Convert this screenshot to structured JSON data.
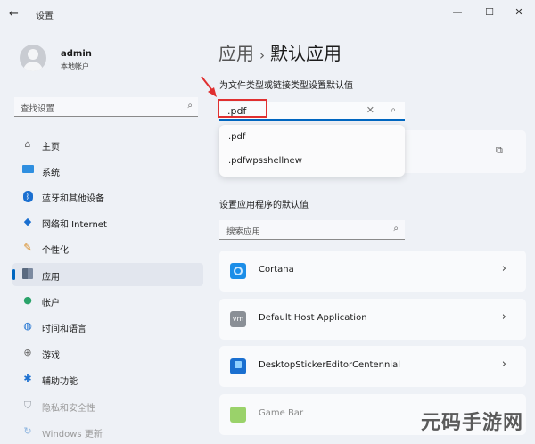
{
  "window": {
    "title": "设置"
  },
  "user": {
    "name": "admin",
    "type": "本地帐户"
  },
  "sidebar": {
    "search_placeholder": "查找设置",
    "items": [
      {
        "label": "主页",
        "icon": "home-icon",
        "active": false
      },
      {
        "label": "系统",
        "icon": "system-icon",
        "active": false
      },
      {
        "label": "蓝牙和其他设备",
        "icon": "bluetooth-icon",
        "active": false
      },
      {
        "label": "网络和 Internet",
        "icon": "wifi-icon",
        "active": false
      },
      {
        "label": "个性化",
        "icon": "brush-icon",
        "active": false
      },
      {
        "label": "应用",
        "icon": "apps-icon",
        "active": true
      },
      {
        "label": "帐户",
        "icon": "account-icon",
        "active": false
      },
      {
        "label": "时间和语言",
        "icon": "globe-icon",
        "active": false
      },
      {
        "label": "游戏",
        "icon": "gamepad-icon",
        "active": false
      },
      {
        "label": "辅助功能",
        "icon": "accessibility-icon",
        "active": false
      },
      {
        "label": "隐私和安全性",
        "icon": "shield-icon",
        "active": false
      },
      {
        "label": "Windows 更新",
        "icon": "update-icon",
        "active": false
      }
    ]
  },
  "main": {
    "breadcrumb_parent": "应用",
    "breadcrumb_current": "默认应用",
    "filetype_label": "为文件类型或链接类型设置默认值",
    "filetype_value": ".pdf",
    "suggestions": [
      ".pdf",
      ".pdfwpsshellnew"
    ],
    "apps_label": "设置应用程序的默认值",
    "app_search_placeholder": "搜索应用",
    "apps": [
      {
        "name": "Cortana",
        "icon": "cortana-icon"
      },
      {
        "name": "Default Host Application",
        "icon": "vm-icon"
      },
      {
        "name": "DesktopStickerEditorCentennial",
        "icon": "sticker-icon"
      },
      {
        "name": "Game Bar",
        "icon": "gamebar-icon"
      }
    ]
  },
  "watermark": "元码手游网",
  "colors": {
    "accent": "#0067c0",
    "annotation": "#e03030"
  }
}
